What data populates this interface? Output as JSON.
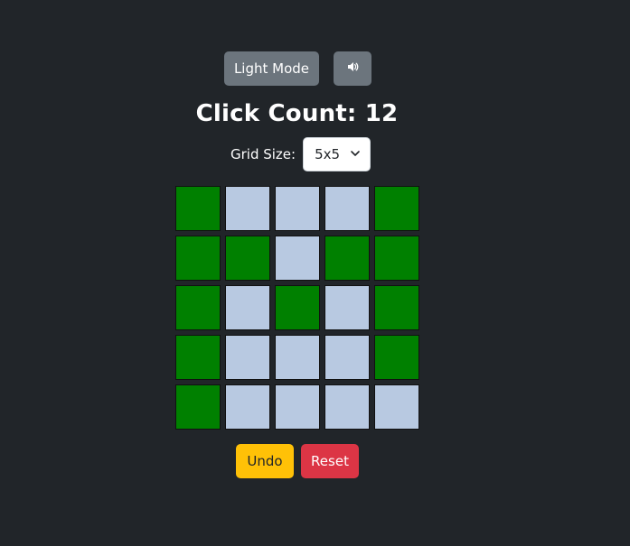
{
  "controls": {
    "mode_label": "Light Mode",
    "sound_icon": "speaker-icon"
  },
  "header": {
    "title_prefix": "Click Count:",
    "click_count": "12",
    "title": "Click Count: 12"
  },
  "grid_size": {
    "label": "Grid Size:",
    "selected": "5x5"
  },
  "board": {
    "rows": 5,
    "cols": 5,
    "on_color": "#008000",
    "off_color": "#b8c9e1",
    "cells": [
      [
        1,
        0,
        0,
        0,
        1
      ],
      [
        1,
        1,
        0,
        1,
        1
      ],
      [
        1,
        0,
        1,
        0,
        1
      ],
      [
        1,
        0,
        0,
        0,
        1
      ],
      [
        1,
        0,
        0,
        0,
        0
      ]
    ]
  },
  "actions": {
    "undo_label": "Undo",
    "reset_label": "Reset"
  },
  "colors": {
    "background": "#212529",
    "secondary": "#6c757d",
    "warning": "#ffc107",
    "danger": "#dc3545"
  }
}
